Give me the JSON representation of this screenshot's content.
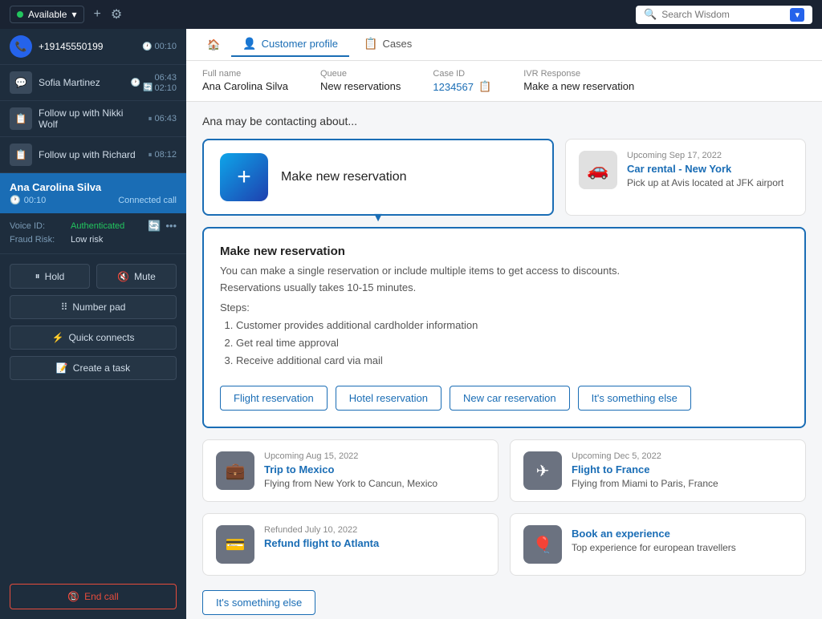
{
  "topbar": {
    "status": "Available",
    "status_color": "#22c55e",
    "plus_icon": "+",
    "gear_icon": "⚙",
    "search_placeholder": "Search Wisdom",
    "search_dropdown": "▾"
  },
  "sidebar": {
    "active_call": {
      "number": "+19145550199",
      "duration": "00:10",
      "clock_icon": "🕐"
    },
    "contacts": [
      {
        "name": "Sofia Martinez",
        "type": "chat",
        "times": [
          "06:43",
          "02:10"
        ]
      },
      {
        "name": "Follow up with Nikki Wolf",
        "type": "task",
        "times": [
          "06:43"
        ],
        "paused": true
      },
      {
        "name": "Follow up with Richard",
        "type": "task",
        "times": [
          "08:12"
        ],
        "paused": true
      }
    ],
    "active_customer": {
      "name": "Ana Carolina Silva",
      "duration": "00:10",
      "status": "Connected call"
    },
    "voice_id": {
      "label": "Voice ID:",
      "value": "Authenticated"
    },
    "fraud_risk": {
      "label": "Fraud Risk:",
      "value": "Low risk"
    },
    "buttons": {
      "hold": "Hold",
      "mute": "Mute",
      "number_pad": "Number pad",
      "quick_connects": "Quick connects",
      "create_task": "Create a task",
      "end_call": "End call"
    }
  },
  "tabs": {
    "home_icon": "🏠",
    "items": [
      {
        "label": "Customer profile",
        "icon": "👤",
        "active": true
      },
      {
        "label": "Cases",
        "icon": "📋",
        "active": false
      }
    ]
  },
  "customer_info": {
    "full_name_label": "Full name",
    "full_name": "Ana Carolina Silva",
    "queue_label": "Queue",
    "queue": "New reservations",
    "case_id_label": "Case ID",
    "case_id": "1234567",
    "ivr_label": "IVR Response",
    "ivr": "Make a new reservation"
  },
  "contact_heading": "Ana may be contacting about...",
  "make_reservation_card": {
    "icon": "+",
    "label": "Make new reservation"
  },
  "upcoming_card": {
    "date": "Upcoming Sep 17, 2022",
    "title": "Car rental - New York",
    "desc": "Pick up at Avis located at JFK airport",
    "icon": "🚗"
  },
  "expanded_panel": {
    "title": "Make new reservation",
    "desc1": "You can make a single reservation or include multiple items to get access to discounts.",
    "desc2": "Reservations usually takes 10-15 minutes.",
    "steps_label": "Steps:",
    "steps": [
      "Customer provides additional cardholder information",
      "Get real time approval",
      "Receive additional card via mail"
    ],
    "action_buttons": [
      "Flight reservation",
      "Hotel reservation",
      "New car reservation",
      "It's something else"
    ]
  },
  "grid_cards": [
    {
      "date": "Upcoming Aug 15, 2022",
      "title": "Trip to Mexico",
      "desc": "Flying from New York to Cancun, Mexico",
      "icon": "💼"
    },
    {
      "date": "Upcoming Dec 5, 2022",
      "title": "Flight to France",
      "desc": "Flying from Miami to Paris, France",
      "icon": "✈"
    },
    {
      "date": "Refunded July 10, 2022",
      "title": "Refund flight to Atlanta",
      "desc": "",
      "icon": "💳"
    },
    {
      "date": "",
      "title": "Book an experience",
      "desc": "Top experience for european travellers",
      "icon": "🎈"
    }
  ],
  "bottom_button": "It's something else"
}
